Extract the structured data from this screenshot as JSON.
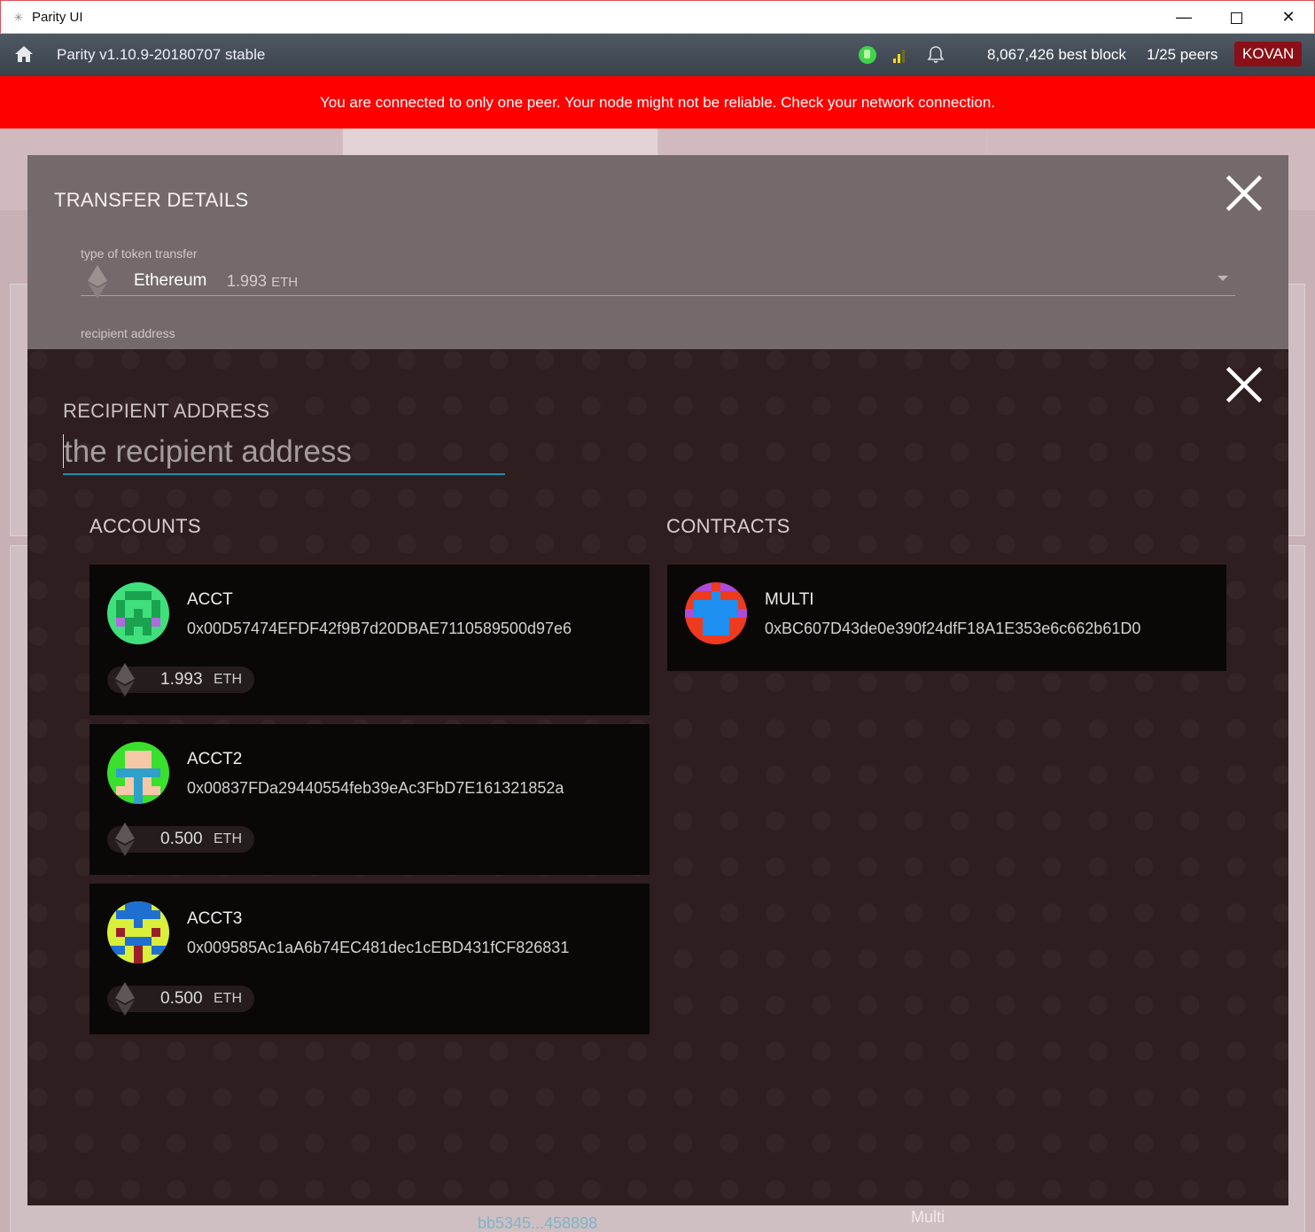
{
  "window": {
    "title": "Parity UI",
    "minimize": "—",
    "close": "✕"
  },
  "header": {
    "version": "Parity v1.10.9-20180707 stable",
    "best_block": "8,067,426 best block",
    "peers": "1/25 peers",
    "network": "KOVAN"
  },
  "warning": {
    "text": "You are connected to only one peer. Your node might not be reliable. Check your network connection."
  },
  "transfer": {
    "title": "TRANSFER DETAILS",
    "token_type_label": "type of token transfer",
    "token_name": "Ethereum",
    "token_balance": "1.993",
    "token_unit": "ETH",
    "recipient_label": "recipient address"
  },
  "recipient": {
    "heading": "RECIPIENT ADDRESS",
    "input_placeholder": "the recipient address",
    "input_value": "",
    "accounts_title": "ACCOUNTS",
    "contracts_title": "CONTRACTS",
    "accounts": [
      {
        "name": "ACCT",
        "address": "0x00D57474EFDF42f9B7d20DBAE7110589500d97e6",
        "balance": "1.993",
        "unit": "ETH"
      },
      {
        "name": "ACCT2",
        "address": "0x00837FDa29440554feb39eAc3FbD7E161321852a",
        "balance": "0.500",
        "unit": "ETH"
      },
      {
        "name": "ACCT3",
        "address": "0x009585Ac1aA6b74EC481dec1cEBD431fCF826831",
        "balance": "0.500",
        "unit": "ETH"
      }
    ],
    "contracts": [
      {
        "name": "MULTI",
        "address": "0xBC607D43de0e390f24dfF18A1E353e6c662b61D0"
      }
    ]
  },
  "background": {
    "footer_address": "bb5345...458898",
    "footer_name": "Multi"
  },
  "colors": {
    "warning": "#ff0000",
    "network_badge": "#8a0f16",
    "input_underline": "#1a8fb0"
  }
}
